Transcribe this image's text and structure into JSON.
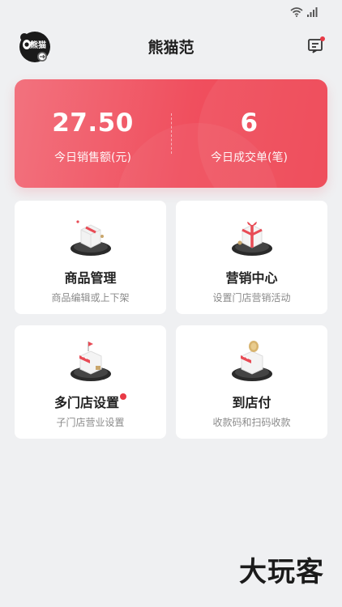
{
  "status_bar": {
    "icons": [
      "wifi-icon",
      "signal-icon"
    ]
  },
  "header": {
    "title": "熊猫范",
    "logo_text": "熊猫",
    "logo_icon": "panda-logo-icon",
    "message_icon": "message-icon",
    "message_badge": true
  },
  "stats": {
    "sales_value": "27.50",
    "sales_label": "今日销售额(元)",
    "orders_value": "6",
    "orders_label": "今日成交单(笔)"
  },
  "tiles": [
    {
      "title": "商品管理",
      "subtitle": "商品编辑或上下架",
      "icon": "product-box-icon"
    },
    {
      "title": "营销中心",
      "subtitle": "设置门店营销活动",
      "icon": "gift-box-icon"
    },
    {
      "title": "多门店设置",
      "subtitle": "子门店营业设置",
      "icon": "multi-store-icon",
      "badge": true
    },
    {
      "title": "到店付",
      "subtitle": "收款码和扫码收款",
      "icon": "store-payment-icon"
    }
  ],
  "watermark": "大玩客",
  "colors": {
    "accent": "#f04f5e",
    "badge": "#e83a46",
    "background": "#eff0f2"
  }
}
